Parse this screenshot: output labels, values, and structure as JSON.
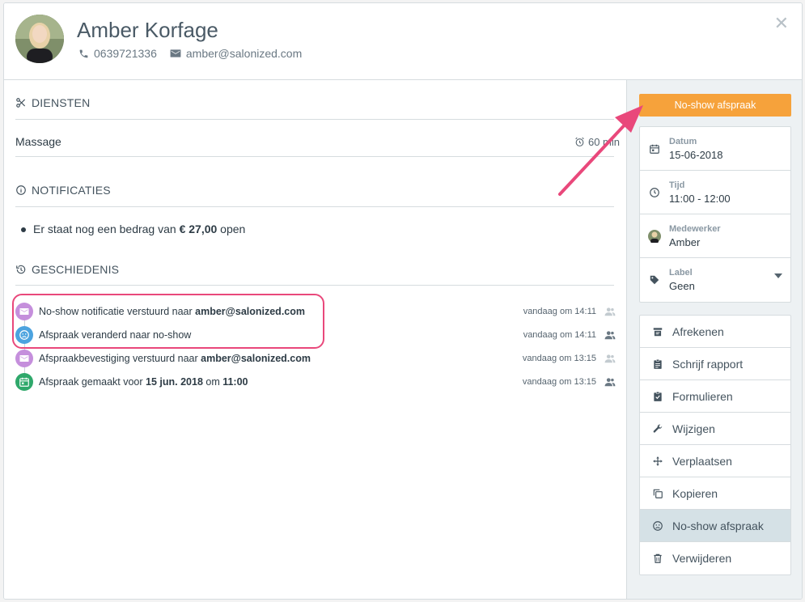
{
  "client": {
    "name": "Amber Korfage",
    "phone": "0639721336",
    "email": "amber@salonized.com"
  },
  "sections": {
    "services_title": "DIENSTEN",
    "notifications_title": "NOTIFICATIES",
    "history_title": "GESCHIEDENIS"
  },
  "service": {
    "name": "Massage",
    "duration": "60 min"
  },
  "notification": {
    "prefix": "Er staat nog een bedrag van ",
    "amount": "€ 27,00",
    "suffix": " open"
  },
  "history": [
    {
      "icon": "mail-icon",
      "color": "#c58fdc",
      "pre": "No-show notificatie verstuurd naar ",
      "bold": "amber@salonized.com",
      "post": "",
      "bold2": "",
      "time": "vandaag om 14:11"
    },
    {
      "icon": "sad-face-icon",
      "color": "#4ca3df",
      "pre": "Afspraak veranderd naar no-show",
      "bold": "",
      "post": "",
      "bold2": "",
      "time": "vandaag om 14:11"
    },
    {
      "icon": "mail-icon",
      "color": "#c58fdc",
      "pre": "Afspraakbevestiging verstuurd naar ",
      "bold": "amber@salonized.com",
      "post": "",
      "bold2": "",
      "time": "vandaag om 13:15"
    },
    {
      "icon": "calendar-icon",
      "color": "#2fa86b",
      "pre": "Afspraak gemaakt voor ",
      "bold": "15 jun. 2018",
      "post": " om ",
      "bold2": "11:00",
      "time": "vandaag om 13:15"
    }
  ],
  "sidebar": {
    "noshow_button": "No-show afspraak",
    "info": [
      {
        "icon": "calendar-icon",
        "label": "Datum",
        "value": "15-06-2018"
      },
      {
        "icon": "clock-icon",
        "label": "Tijd",
        "value": "11:00 - 12:00"
      },
      {
        "icon": "avatar-icon",
        "label": "Medewerker",
        "value": "Amber"
      },
      {
        "icon": "tag-icon",
        "label": "Label",
        "value": "Geen"
      }
    ],
    "actions": [
      {
        "icon": "receipt-icon",
        "label": "Afrekenen"
      },
      {
        "icon": "clipboard-icon",
        "label": "Schrijf rapport"
      },
      {
        "icon": "form-check-icon",
        "label": "Formulieren"
      },
      {
        "icon": "wrench-icon",
        "label": "Wijzigen"
      },
      {
        "icon": "move-icon",
        "label": "Verplaatsen"
      },
      {
        "icon": "copy-icon",
        "label": "Kopieren"
      },
      {
        "icon": "sad-face-icon",
        "label": "No-show afspraak"
      },
      {
        "icon": "trash-icon",
        "label": "Verwijderen"
      }
    ]
  },
  "colors": {
    "accent_orange": "#f6a23b",
    "annotation_pink": "#e9487b",
    "active_action": "#d5e1e6"
  }
}
